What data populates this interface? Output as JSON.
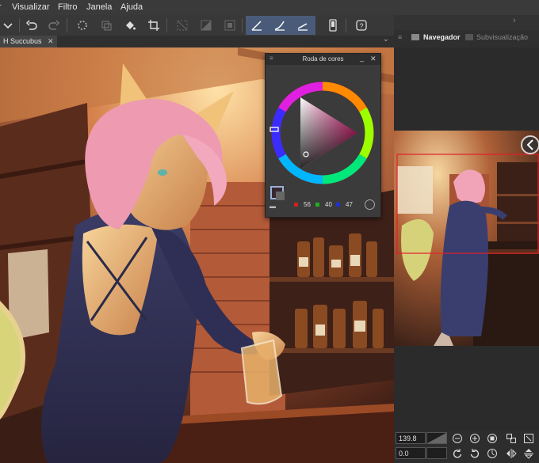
{
  "menubar": {
    "items": [
      "Visualizar",
      "Filtro",
      "Janela",
      "Ajuda"
    ]
  },
  "tabs": {
    "document": "H Succubus",
    "close": "✕"
  },
  "color_wheel": {
    "title": "Roda de cores",
    "r": "56",
    "g": "40",
    "b": "47",
    "colors": {
      "r": "#d02020",
      "g": "#20b020",
      "b": "#2030d0"
    }
  },
  "navigator": {
    "tab_active": "Navegador",
    "tab_inactive": "Subvisualização",
    "zoom": "139.8",
    "rotation": "0.0"
  },
  "colors": {
    "accent": "#4a5b7a",
    "panel_bg": "#2b2b2b"
  }
}
